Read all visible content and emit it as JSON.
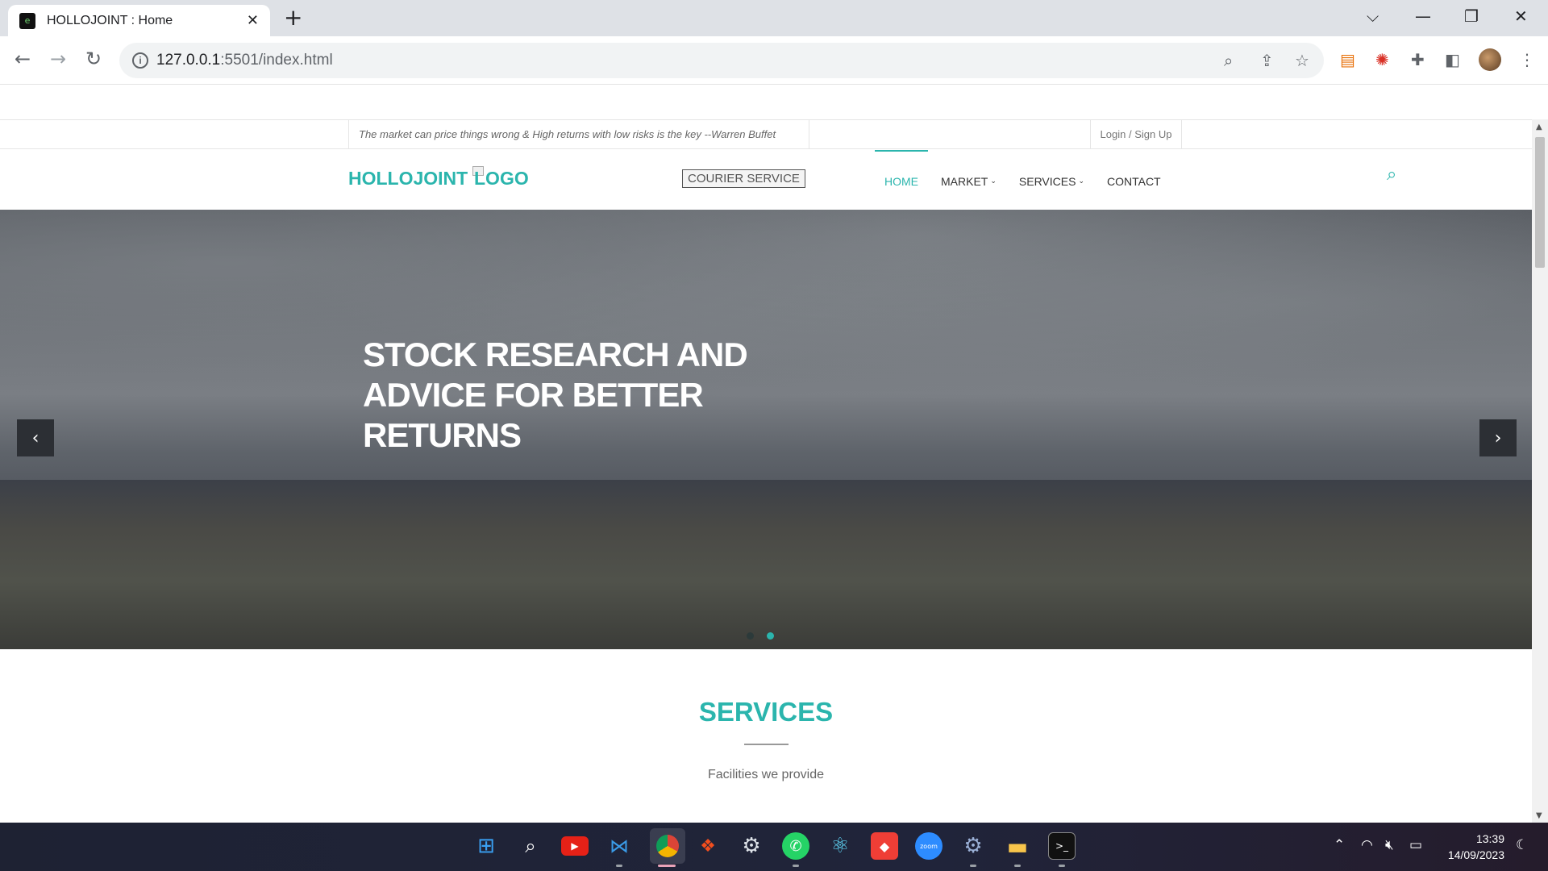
{
  "browser": {
    "tab_title": "HOLLOJOINT : Home",
    "url_host": "127.0.0.1",
    "url_rest": ":5501/index.html"
  },
  "site": {
    "quote": "The market can price things wrong  &  High returns with low risks is the key   --Warren Buffet",
    "login": "Login / Sign Up",
    "brand": "HOLLOJOINT",
    "logo_alt": "LOGO",
    "courier": "COURIER SERVICE",
    "menu": [
      {
        "label": "HOME",
        "active": true,
        "caret": false
      },
      {
        "label": "MARKET",
        "active": false,
        "caret": true
      },
      {
        "label": "SERVICES",
        "active": false,
        "caret": true
      },
      {
        "label": "CONTACT",
        "active": false,
        "caret": false
      }
    ],
    "hero": {
      "title": "STOCK RESEARCH AND ADVICE FOR BETTER RETURNS",
      "slide_count": 2,
      "active_slide": 2
    },
    "services": {
      "title": "SERVICES",
      "subtitle": "Facilities we provide"
    }
  },
  "colors": {
    "accent": "#2bb5ad"
  },
  "taskbar": {
    "time": "13:39",
    "date": "14/09/2023",
    "apps": [
      "windows-start",
      "search",
      "youtube",
      "vscode",
      "chrome",
      "figma",
      "settings-gear",
      "whatsapp",
      "react",
      "git",
      "zoom",
      "chrome-settings",
      "file-explorer",
      "terminal"
    ]
  }
}
